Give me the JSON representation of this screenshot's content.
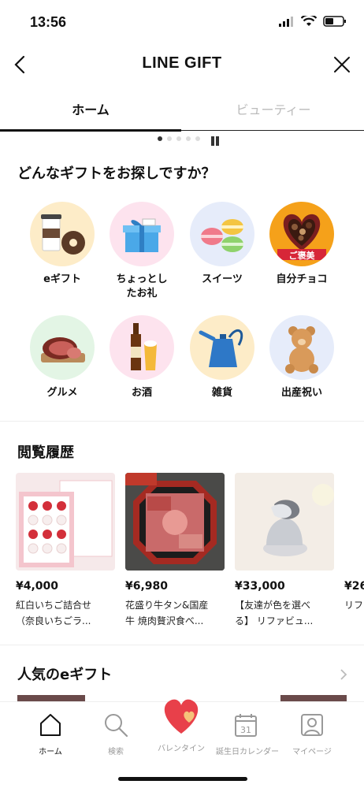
{
  "status_bar": {
    "time": "13:56"
  },
  "nav": {
    "title": "LINE GIFT"
  },
  "tabs": [
    {
      "label": "ホーム",
      "active": true
    },
    {
      "label": "ビューティー",
      "active": false
    }
  ],
  "search_section": {
    "title": "どんなギフトをお探しですか？",
    "categories": [
      {
        "label": "eギフト",
        "icon": "coffee-donut-icon"
      },
      {
        "label": "ちょっとした\nたお礼",
        "line1": "ちょっとし",
        "line2": "たお礼",
        "icon": "gift-box-icon"
      },
      {
        "label": "スイーツ",
        "icon": "macaron-icon"
      },
      {
        "label": "自分チョコ",
        "icon": "chocolate-box-icon",
        "badge": "ご褒美"
      },
      {
        "label": "グルメ",
        "icon": "roast-beef-icon"
      },
      {
        "label": "お酒",
        "icon": "beer-icon"
      },
      {
        "label": "雑貨",
        "icon": "kettle-icon"
      },
      {
        "label": "出産祝い",
        "icon": "teddy-bear-icon"
      }
    ]
  },
  "history_section": {
    "title": "閲覧履歴",
    "items": [
      {
        "price": "¥4,000",
        "name_line1": "紅白いちご詰合せ",
        "name_line2": "（奈良いちごラ..."
      },
      {
        "price": "¥6,980",
        "name_line1": "花盛り牛タン&国産",
        "name_line2": "牛 焼肉贅沢食べ..."
      },
      {
        "price": "¥33,000",
        "name_line1": "【友達が色を選べ",
        "name_line2": "る】 リファビュ..."
      },
      {
        "price": "¥26",
        "name_line1": "リフ",
        "name_line2": ""
      }
    ]
  },
  "popular_section": {
    "title": "人気のeギフト"
  },
  "bottom_nav": [
    {
      "label": "ホーム",
      "icon": "home-icon",
      "active": true
    },
    {
      "label": "検索",
      "icon": "search-icon",
      "active": false
    },
    {
      "label": "バレンタイン",
      "icon": "heart-icon",
      "active": false
    },
    {
      "label": "誕生日カレンダー",
      "icon": "calendar-icon",
      "calendar_day": "31",
      "active": false
    },
    {
      "label": "マイページ",
      "icon": "person-icon",
      "active": false
    }
  ],
  "colors": {
    "accent": "#e8404a",
    "inactive": "#999999",
    "text": "#111111"
  }
}
